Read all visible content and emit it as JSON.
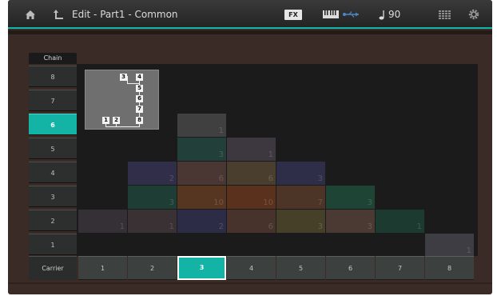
{
  "header": {
    "title": "Edit - Part1 - Common",
    "fx_label": "FX",
    "tempo_value": "90",
    "icons": [
      "home-icon",
      "back-arrow-icon",
      "midi-keyboard-icon",
      "usb-icon",
      "note-icon",
      "grid-icon",
      "gear-icon"
    ]
  },
  "chain": {
    "header": "Chain",
    "items": [
      "8",
      "7",
      "6",
      "5",
      "4",
      "3",
      "2",
      "1"
    ],
    "selected": "6"
  },
  "carrier": {
    "label": "Carrier",
    "items": [
      "1",
      "2",
      "3",
      "4",
      "5",
      "6",
      "7",
      "8"
    ],
    "selected": "3"
  },
  "algorithm_thumbnail": {
    "operators": [
      "3",
      "4",
      "5",
      "6",
      "7",
      "1",
      "2",
      "8"
    ]
  },
  "grid_blocks": [
    {
      "col": 3,
      "row": 6,
      "num": "1",
      "color": "#414041"
    },
    {
      "col": 3,
      "row": 5,
      "num": "3",
      "color": "#233f3a"
    },
    {
      "col": 4,
      "row": 5,
      "num": "1",
      "color": "#3d3840"
    },
    {
      "col": 2,
      "row": 4,
      "num": "2",
      "color": "#302e48"
    },
    {
      "col": 3,
      "row": 4,
      "num": "6",
      "color": "#4a3633"
    },
    {
      "col": 4,
      "row": 4,
      "num": "6",
      "color": "#4a3e2e"
    },
    {
      "col": 5,
      "row": 4,
      "num": "3",
      "color": "#2f2e48"
    },
    {
      "col": 2,
      "row": 3,
      "num": "3",
      "color": "#1e3d35"
    },
    {
      "col": 3,
      "row": 3,
      "num": "10",
      "color": "#563621"
    },
    {
      "col": 4,
      "row": 3,
      "num": "10",
      "color": "#5a311c"
    },
    {
      "col": 5,
      "row": 3,
      "num": "7",
      "color": "#4c3426"
    },
    {
      "col": 6,
      "row": 3,
      "num": "3",
      "color": "#1e4436"
    },
    {
      "col": 1,
      "row": 2,
      "num": "1",
      "color": "#353036"
    },
    {
      "col": 2,
      "row": 2,
      "num": "1",
      "color": "#3a3134"
    },
    {
      "col": 3,
      "row": 2,
      "num": "2",
      "color": "#2d2c47"
    },
    {
      "col": 4,
      "row": 2,
      "num": "6",
      "color": "#47332b"
    },
    {
      "col": 5,
      "row": 2,
      "num": "3",
      "color": "#464029"
    },
    {
      "col": 6,
      "row": 2,
      "num": "3",
      "color": "#4a3a33"
    },
    {
      "col": 7,
      "row": 2,
      "num": "1",
      "color": "#1c3a30"
    },
    {
      "col": 8,
      "row": 1,
      "num": "1",
      "color": "#3e3d44"
    }
  ]
}
